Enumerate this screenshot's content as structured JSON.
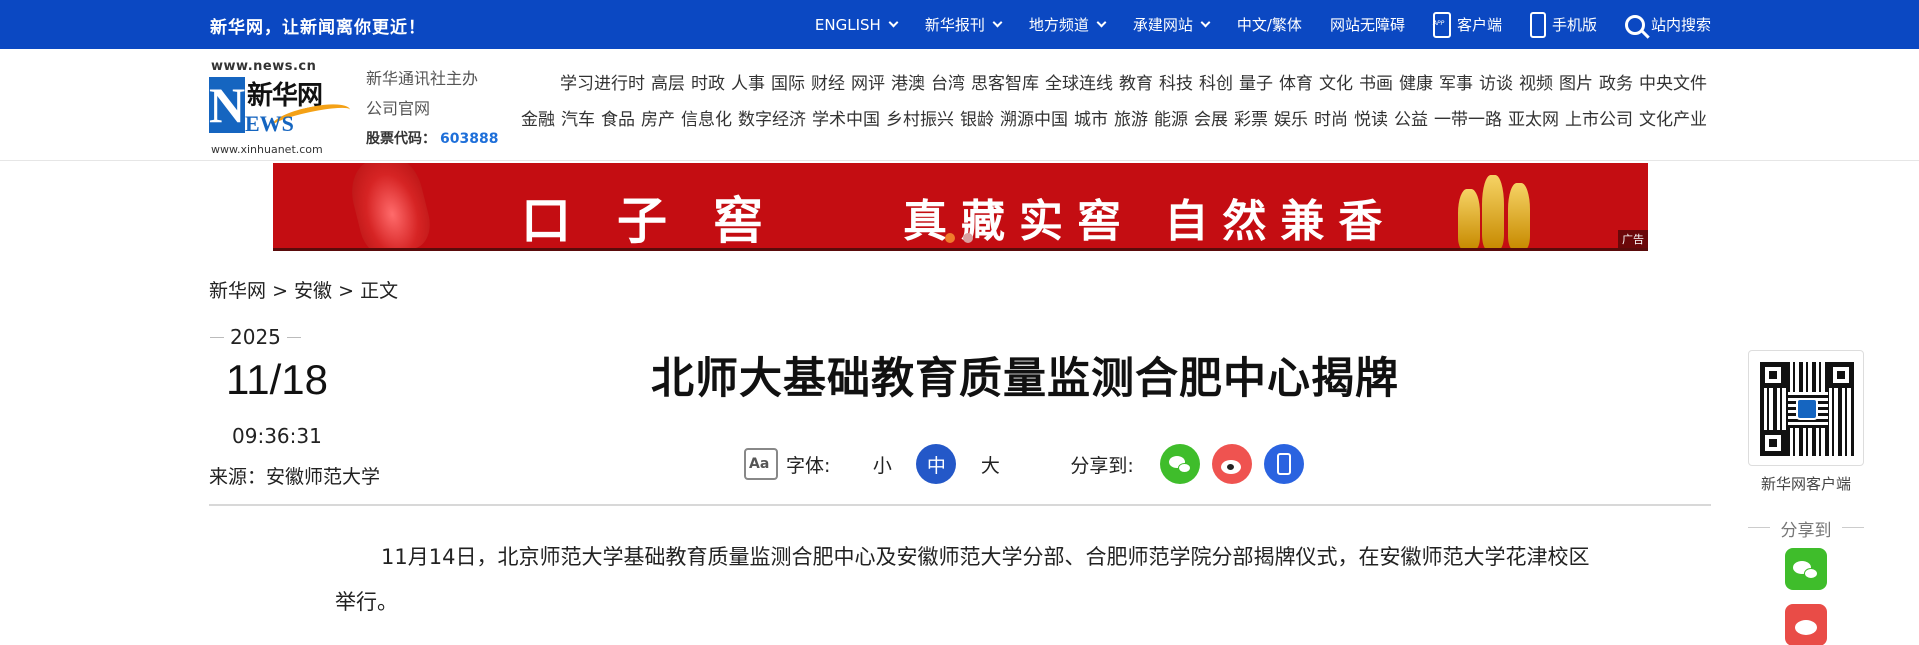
{
  "topbar": {
    "slogan": "新华网，让新闻离你更近！",
    "nav": [
      {
        "label": "ENGLISH",
        "dropdown": true
      },
      {
        "label": "新华报刊",
        "dropdown": true
      },
      {
        "label": "地方频道",
        "dropdown": true
      },
      {
        "label": "承建网站",
        "dropdown": true
      },
      {
        "label": "中文/繁体",
        "dropdown": false
      },
      {
        "label": "网站无障碍",
        "dropdown": false
      },
      {
        "label": "客户端",
        "icon": "app-icon"
      },
      {
        "label": "手机版",
        "icon": "phone-icon"
      },
      {
        "label": "站内搜索",
        "icon": "search-icon"
      }
    ]
  },
  "logo": {
    "domain_top": "www.news.cn",
    "cn_name": "新华网",
    "en_mark": "NEWS",
    "domain_bottom": "www.xinhuanet.com"
  },
  "org": {
    "line1": "新华通讯社主办",
    "line2": "公司官网",
    "stock_label": "股票代码：",
    "stock_code": "603888"
  },
  "channels": {
    "row1": [
      "学习进行时",
      "高层",
      "时政",
      "人事",
      "国际",
      "财经",
      "网评",
      "港澳",
      "台湾",
      "思客智库",
      "全球连线",
      "教育",
      "科技",
      "科创",
      "量子",
      "体育",
      "文化",
      "书画",
      "健康",
      "军事",
      "访谈",
      "视频",
      "图片",
      "政务",
      "中央文件"
    ],
    "row2": [
      "金融",
      "汽车",
      "食品",
      "房产",
      "信息化",
      "数字经济",
      "学术中国",
      "乡村振兴",
      "银龄",
      "溯源中国",
      "城市",
      "旅游",
      "能源",
      "会展",
      "彩票",
      "娱乐",
      "时尚",
      "悦读",
      "公益",
      "一带一路",
      "亚太网",
      "上市公司",
      "文化产业"
    ]
  },
  "ad": {
    "brand": "口子窖",
    "tagline": "真藏实窖 自然兼香",
    "tag": "广告"
  },
  "breadcrumb": {
    "home": "新华网",
    "sep": ">",
    "section": "安徽",
    "current": "正文"
  },
  "article_meta": {
    "year": "2025",
    "month_day": "11/18",
    "time": "09:36:31",
    "source": "来源：安徽师范大学"
  },
  "article": {
    "title": "北师大基础教育质量监测合肥中心揭牌",
    "font_label": "字体:",
    "font_sizes": [
      "小",
      "中",
      "大"
    ],
    "share_label": "分享到:",
    "body": "11月14日，北京师范大学基础教育质量监测合肥中心及安徽师范大学分部、合肥师范学院分部揭牌仪式，在安徽师范大学花津校区举行。"
  },
  "sidebar": {
    "qr_caption": "新华网客户端",
    "share_label": "分享到"
  }
}
